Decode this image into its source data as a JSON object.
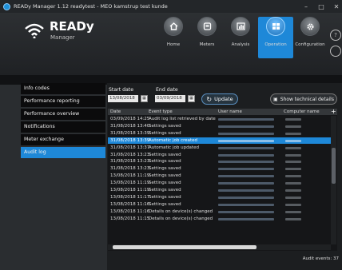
{
  "window": {
    "title": "READy Manager 1.12 readytest - MEO kamstrup test kunde"
  },
  "logo": {
    "name": "READy",
    "sub": "Manager"
  },
  "nav": [
    {
      "label": "Home",
      "icon": "home-icon"
    },
    {
      "label": "Meters",
      "icon": "meters-icon"
    },
    {
      "label": "Analysis",
      "icon": "analysis-icon"
    },
    {
      "label": "Operation",
      "icon": "operation-icon",
      "active": true
    },
    {
      "label": "Configuration",
      "icon": "configuration-icon"
    }
  ],
  "sidebar": {
    "items": [
      {
        "label": "Info codes"
      },
      {
        "label": "Performance reporting"
      },
      {
        "label": "Performance overview"
      },
      {
        "label": "Notifications"
      },
      {
        "label": "Meter exchange"
      },
      {
        "label": "Audit log",
        "active": true
      }
    ]
  },
  "filters": {
    "start_label": "Start date",
    "start_value": "13/08/2018",
    "end_label": "End date",
    "end_value": "03/09/2018",
    "update_label": "Update",
    "tech_label": "Show technical details"
  },
  "table": {
    "columns": [
      "Date",
      "Event type",
      "User name",
      "Computer name"
    ],
    "rows": [
      {
        "date": "03/09/2018 14:25",
        "event": "Audit log list retrieved by date"
      },
      {
        "date": "31/08/2018 13:40",
        "event": "Settings saved"
      },
      {
        "date": "31/08/2018 13:39",
        "event": "Settings saved"
      },
      {
        "date": "31/08/2018 13:39",
        "event": "Automatic job created",
        "selected": true
      },
      {
        "date": "31/08/2018 13:37",
        "event": "Automatic job updated"
      },
      {
        "date": "31/08/2018 13:23",
        "event": "Settings saved"
      },
      {
        "date": "31/08/2018 13:23",
        "event": "Settings saved"
      },
      {
        "date": "31/08/2018 13:23",
        "event": "Settings saved"
      },
      {
        "date": "13/08/2018 11:19",
        "event": "Settings saved"
      },
      {
        "date": "13/08/2018 11:19",
        "event": "Settings saved"
      },
      {
        "date": "13/08/2018 11:19",
        "event": "Settings saved"
      },
      {
        "date": "13/08/2018 11:17",
        "event": "Settings saved"
      },
      {
        "date": "13/08/2018 11:16",
        "event": "Settings saved"
      },
      {
        "date": "13/08/2018 11:16",
        "event": "Details on device(s) changed"
      },
      {
        "date": "13/08/2018 11:15",
        "event": "Details on device(s) changed"
      }
    ]
  },
  "footer": {
    "events": "Audit events: 37"
  },
  "colors": {
    "accent": "#1e88d8",
    "background": "#2a2d30",
    "selected_row": "#1e88d8"
  }
}
